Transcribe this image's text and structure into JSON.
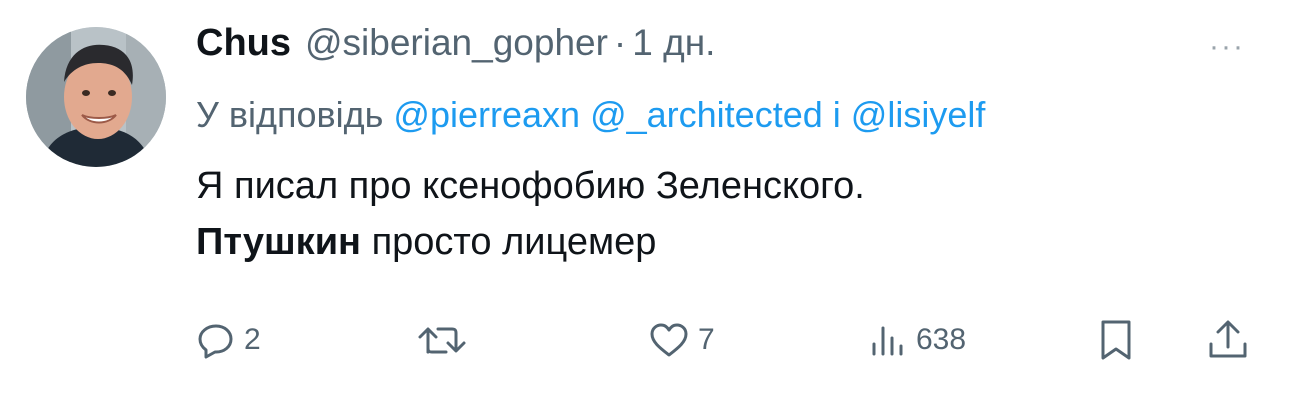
{
  "author": {
    "name": "Chus",
    "handle": "@siberian_gopher",
    "separator": "·",
    "time": "1 дн."
  },
  "more_label": "···",
  "reply_context": {
    "prefix": "У відповідь",
    "mentions": [
      "@pierreaxn",
      "@_architected"
    ],
    "conjunction": "і",
    "last_mention": "@lisiyelf"
  },
  "tweet": {
    "line1": "Я писал про ксенофобию Зеленского.",
    "bold_word": "Птушкин",
    "line2_rest": "просто лицемер"
  },
  "actions": {
    "replies": "2",
    "retweets": "",
    "likes": "7",
    "views": "638"
  },
  "colors": {
    "text": "#0f1419",
    "secondary": "#536471",
    "link": "#1d9bf0"
  }
}
